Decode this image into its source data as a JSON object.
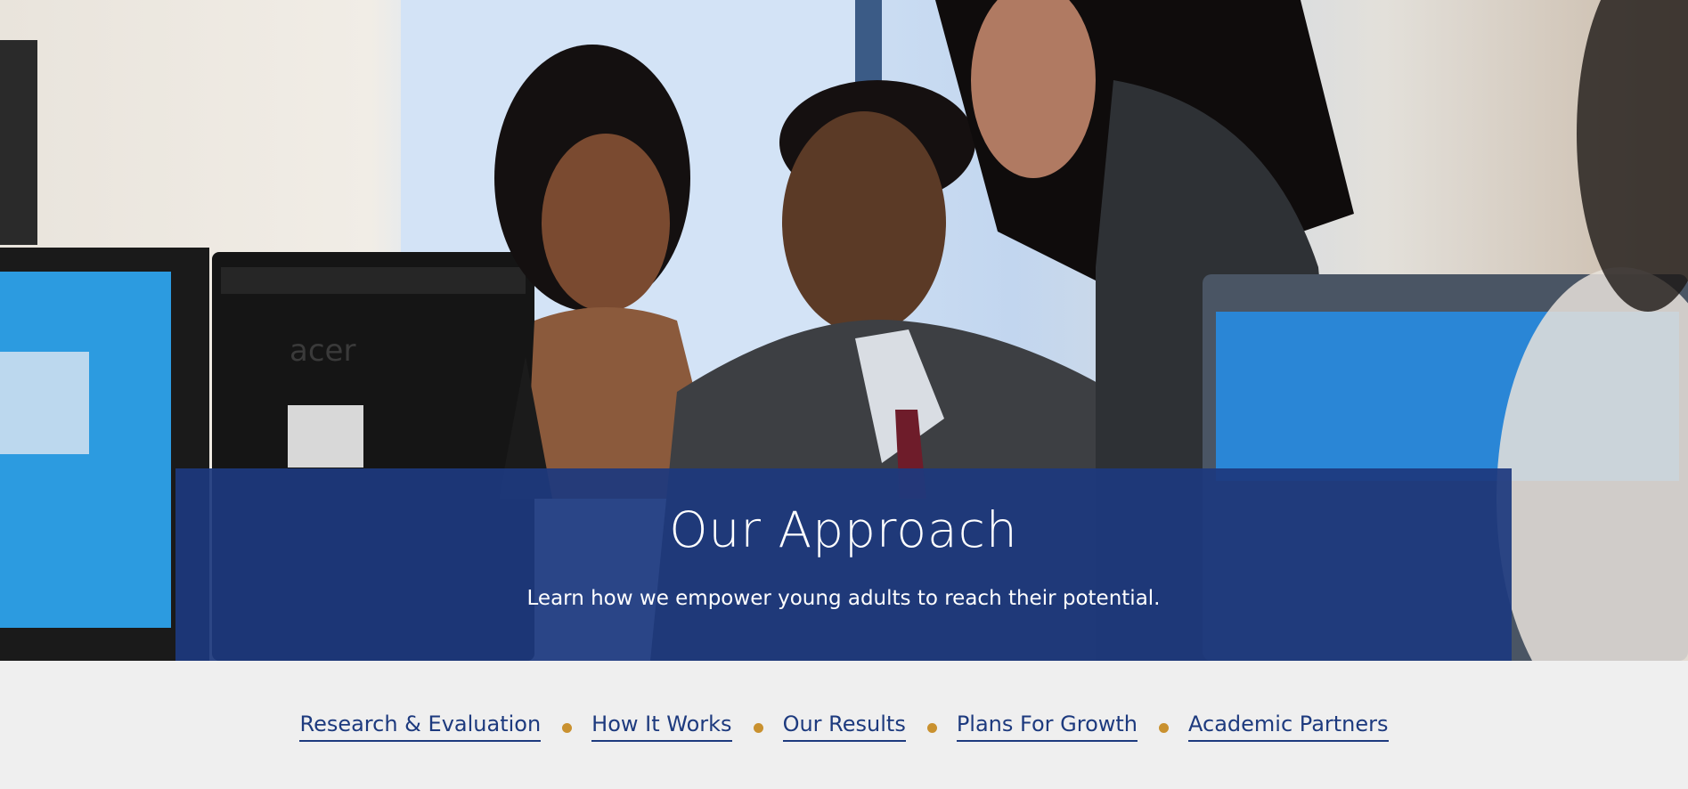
{
  "hero": {
    "title": "Our Approach",
    "subtitle": "Learn how we empower young adults to reach their potential.",
    "photo_icon": "people-at-computers-photo",
    "monitor_brand": "acer"
  },
  "subnav": {
    "items": [
      {
        "label": "Research & Evaluation"
      },
      {
        "label": "How It Works"
      },
      {
        "label": "Our Results"
      },
      {
        "label": "Plans For Growth"
      },
      {
        "label": "Academic Partners"
      }
    ],
    "separator_color": "#c9912f"
  },
  "colors": {
    "brand_blue": "#1d397e",
    "link_blue": "#1d3a7e",
    "accent_gold": "#c9912f",
    "band_gray": "#efefef"
  }
}
